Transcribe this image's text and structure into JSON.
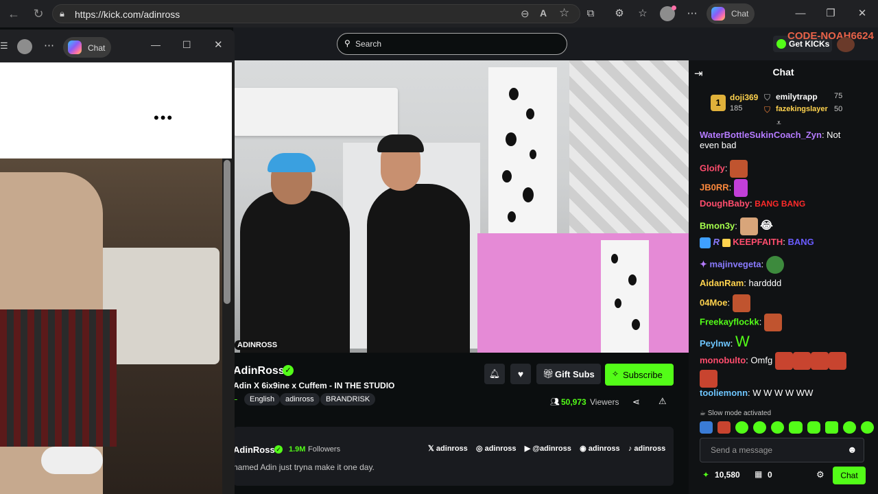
{
  "browser": {
    "url": "https://kick.com/adinross",
    "chat_label": "Chat"
  },
  "sidewin": {
    "chat_label": "Chat",
    "dots": "•••"
  },
  "kick": {
    "search_placeholder": "Search",
    "get_kicks": "Get KICKs",
    "overlay_code": "CODE-NOAH6624"
  },
  "stream": {
    "channel": "AdinRoss",
    "title": "Adin X 6ix9ine x Cuffem - IN THE STUDIO",
    "tags": [
      "English",
      "adinross",
      "BRANDRISK"
    ],
    "viewers": "50,973",
    "viewers_label": "Viewers",
    "gift_subs": "Gift Subs",
    "subscribe": "Subscribe",
    "about_name": "AdinRoss",
    "followers_count": "1.9M",
    "followers_label": "Followers",
    "bio": "named Adin just tryna make it one day.",
    "socials": [
      "adinross",
      "adinross",
      "@adinross",
      "adinross",
      "adinross"
    ],
    "overlay_watermark": "ADINROSS"
  },
  "chat": {
    "title": "Chat",
    "leaderboard": {
      "first_name": "doji369",
      "first_value": "185",
      "rank": "1",
      "second_name": "emilytrapp",
      "second_value": "75",
      "third_name": "fazekingslayer",
      "third_value": "50"
    },
    "messages": [
      {
        "user": "WaterBottleSukinCoach_Zyn",
        "text": "Not",
        "text2": "even bad",
        "color": "#b57bff"
      },
      {
        "user": "Gloify",
        "text": "",
        "color": "#ff4d6d"
      },
      {
        "user": "JB0RR",
        "text": "",
        "color": "#ff8a3d"
      },
      {
        "user": "DoughBaby",
        "text": "",
        "color": "#ff4d6d",
        "emote_text": "BANG BANG"
      },
      {
        "user": "Bmon3y",
        "text": "",
        "color": "#a6ff4d"
      },
      {
        "user": "KEEPFAITH",
        "text": "",
        "color": "#ff4d6d",
        "emote_text": "BANG"
      },
      {
        "user": "majinvegeta",
        "text": "",
        "color": "#8a7bff"
      },
      {
        "user": "AidanRam",
        "text": "hardddd",
        "color": "#ffd34e"
      },
      {
        "user": "04Moe",
        "text": "",
        "color": "#ffd34e"
      },
      {
        "user": "Freekayflockk",
        "text": "",
        "color": "#53fc18"
      },
      {
        "user": "Peylnw",
        "text": "W",
        "color": "#6ec6ff"
      },
      {
        "user": "monobulto",
        "text": "Omfg",
        "color": "#ff4d6d"
      },
      {
        "user": "tooliemonn",
        "text": "W W W W WW",
        "color": "#6ec6ff"
      }
    ],
    "slow_mode": "Slow mode activated",
    "input_placeholder": "Send a message",
    "points": "10,580",
    "store_count": "0",
    "send_label": "Chat"
  }
}
